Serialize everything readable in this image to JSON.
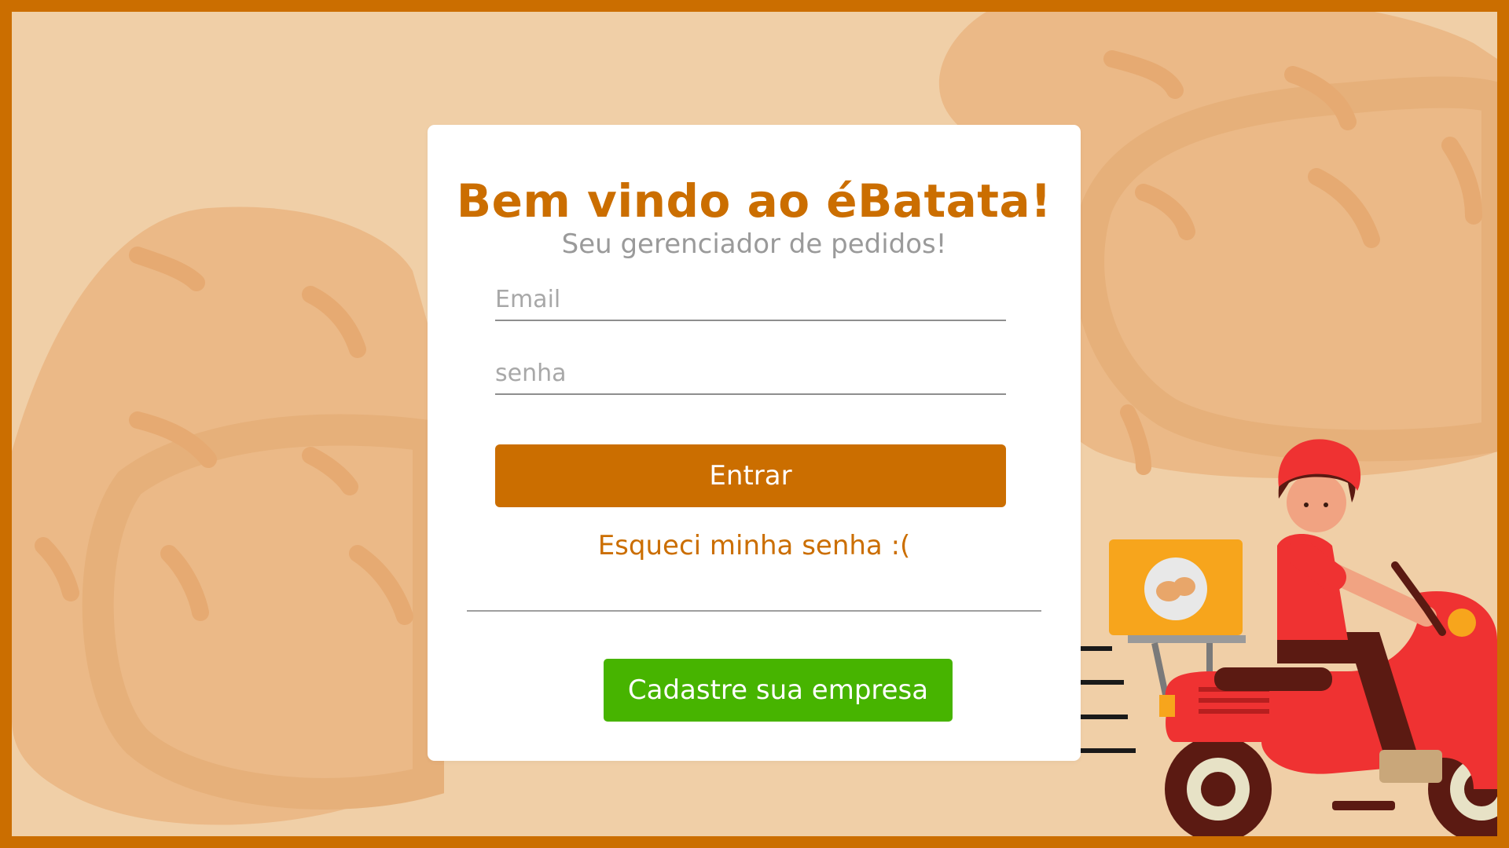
{
  "login": {
    "title": "Bem vindo ao éBatata!",
    "subtitle": "Seu gerenciador de pedidos!",
    "email_placeholder": "Email",
    "password_placeholder": "senha",
    "submit_label": "Entrar",
    "forgot_label": "Esqueci minha senha :(",
    "register_label": "Cadastre sua empresa"
  },
  "icons": {
    "background": "potato-pattern-illustration",
    "courier": "delivery-scooter-illustration",
    "box_logo": "potato-icon"
  },
  "colors": {
    "brand_orange": "#cb6e00",
    "background_peach": "#f0cfa7",
    "register_green": "#47b400",
    "subtitle_gray": "#9a9a9a",
    "scooter_red": "#ef3232"
  }
}
